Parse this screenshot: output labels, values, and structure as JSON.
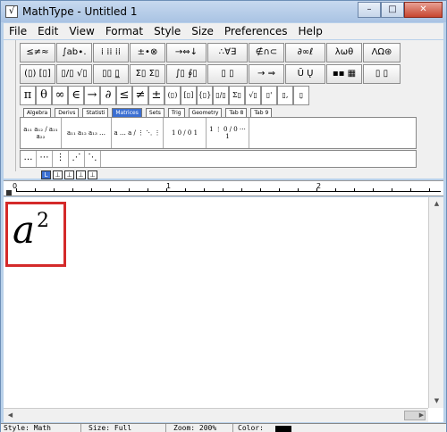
{
  "window": {
    "title": "MathType - Untitled 1",
    "buttons": {
      "minimize": "–",
      "maximize": "□",
      "close": "✕"
    }
  },
  "menu": [
    {
      "label": "File"
    },
    {
      "label": "Edit"
    },
    {
      "label": "View"
    },
    {
      "label": "Format"
    },
    {
      "label": "Style"
    },
    {
      "label": "Size"
    },
    {
      "label": "Preferences"
    },
    {
      "label": "Help"
    }
  ],
  "palette_row1": [
    "≤≠≈",
    "∫ab∙.",
    "⁞ ⁞⁞ ⁞⁞",
    "±•⊗",
    "→⇔↓",
    "∴∀∃",
    "∉∩⊂",
    "∂∞ℓ",
    "λωθ",
    "ΛΩ⊛"
  ],
  "palette_row2": [
    "(▯) [▯]",
    "▯/▯ √▯",
    "▯▯ ▯̲",
    "Σ▯ Σ▯",
    "∫▯ ∮▯",
    "▯ ▯",
    "→ ⇒",
    "Ū Ų",
    "▪▪ ▦",
    "▯ ▯"
  ],
  "palette_row3": [
    "π",
    "θ",
    "∞",
    "∈",
    "→",
    "∂",
    "≤",
    "≠",
    "±",
    "(▯)",
    "[▯]",
    "{▯}",
    "▯/▯",
    "Σ▯",
    "√▯",
    "▯'",
    "▯,",
    "▯̦"
  ],
  "template_tabs": [
    "Algebra",
    "Derivs",
    "Statisti",
    "Matrices",
    "Sets",
    "Trig",
    "Geometry",
    "Tab 8",
    "Tab 9"
  ],
  "active_tab": "Matrices",
  "template_items": [
    {
      "label": "a₁₁ a₁₂ / a₂₁ a₂₂"
    },
    {
      "label": "a₁₁ a₁₂ a₁₃ …"
    },
    {
      "label": "a … a / ⋮ ⋱ ⋮"
    },
    {
      "label": "1 0 / 0 1"
    },
    {
      "label": "1 ⋮ 0 / 0 ⋯ 1"
    }
  ],
  "small_row": [
    "…",
    "⋯",
    "⋮",
    "⋰",
    "⋱"
  ],
  "tab_icons": [
    "L",
    "⊥",
    "⊥",
    "⊥",
    "⊥"
  ],
  "ruler": {
    "labels": [
      "0",
      "1",
      "2"
    ]
  },
  "equation": {
    "base": "a",
    "exponent": "2"
  },
  "status": {
    "style": "Style: Math",
    "size": "Size: Full",
    "zoom": "Zoom: 200%",
    "color": "Color:"
  },
  "colors": {
    "highlight": "#d42a2a",
    "active_tab": "#3b6fd2",
    "swatch": "#000000"
  }
}
